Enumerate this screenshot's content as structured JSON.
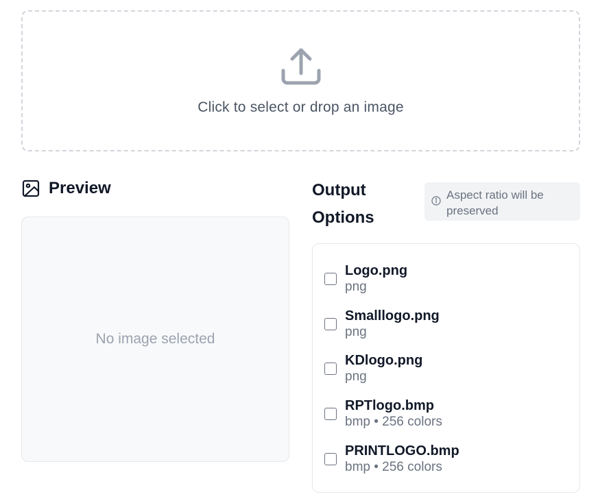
{
  "dropzone": {
    "icon": "upload-icon",
    "text": "Click to select or drop an image"
  },
  "preview": {
    "icon": "image-icon",
    "title": "Preview",
    "empty_text": "No image selected"
  },
  "output": {
    "title": "Output Options",
    "note_icon": "info-icon",
    "note": "Aspect ratio will be preserved",
    "options": [
      {
        "name": "Logo.png",
        "meta": "png",
        "checked": false
      },
      {
        "name": "Smalllogo.png",
        "meta": "png",
        "checked": false
      },
      {
        "name": "KDlogo.png",
        "meta": "png",
        "checked": false
      },
      {
        "name": "RPTlogo.bmp",
        "meta": "bmp • 256 colors",
        "checked": false
      },
      {
        "name": "PRINTLOGO.bmp",
        "meta": "bmp • 256 colors",
        "checked": false
      }
    ]
  },
  "colors": {
    "icon_gray": "#9ca3af",
    "dashed_border": "#d1d5db",
    "muted_text": "#6b7280"
  }
}
